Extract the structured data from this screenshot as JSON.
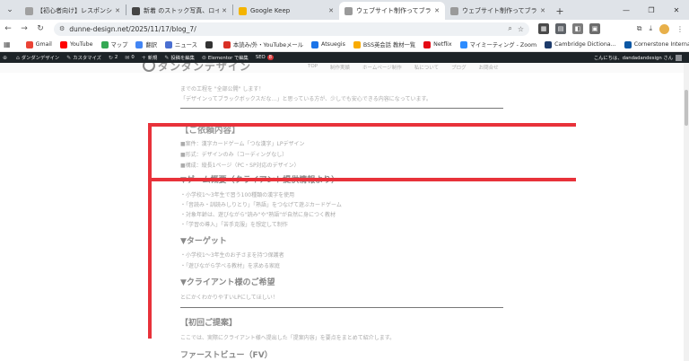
{
  "tabs": [
    {
      "title": "【初心者向け】レスポンシブデザインとは",
      "active": false,
      "color": "#a0a0a0"
    },
    {
      "title": "新着 のストック写真、ロイヤリティフリー",
      "active": false,
      "color": "#444444"
    },
    {
      "title": "Google Keep",
      "active": false,
      "color": "#f4b400"
    },
    {
      "title": "ウェブサイト制作ってブラックボックス",
      "active": true,
      "color": "#9a9a9a"
    },
    {
      "title": "ウェブサイト制作ってブラックボックス",
      "active": false,
      "color": "#9a9a9a"
    }
  ],
  "toolbar": {
    "url": "dunne-design.net/2025/11/17/blog_7/"
  },
  "bookmarks": [
    {
      "label": "Gmail",
      "color": "#ea4335"
    },
    {
      "label": "YouTube",
      "color": "#ff0000"
    },
    {
      "label": "マップ",
      "color": "#34a853"
    },
    {
      "label": "翻訳",
      "color": "#4285f4"
    },
    {
      "label": "ニュース",
      "color": "#4a6fd1"
    },
    {
      "label": "",
      "color": "#333333"
    },
    {
      "label": "本読み/外・YouTubeメール",
      "color": "#d93025"
    },
    {
      "label": "Atsuegis",
      "color": "#1a73e8"
    },
    {
      "label": "BSS英会話 教材一覧",
      "color": "#f9ab00"
    },
    {
      "label": "Netflix",
      "color": "#e50914"
    },
    {
      "label": "マイミーティング - Zoom",
      "color": "#2d8cff"
    },
    {
      "label": "Cambridge Dictiona...",
      "color": "#1d3b6b"
    },
    {
      "label": "Cornerstone Interna...",
      "color": "#0b57a4"
    }
  ],
  "bookmarks_all": "All Bookmarks",
  "adminbar": {
    "site": "ダンダンデザイン",
    "customize": "カスタマイズ",
    "updates": "2",
    "comments": "0",
    "new": "新規",
    "edit": "投稿を編集",
    "elementor": "Elementor で編集",
    "seo": "SEO",
    "seo_badge": "8",
    "greeting": "こんにちは、dandadandesign さん"
  },
  "site": {
    "logo": "ダンダンデザイン",
    "nav": [
      "TOP",
      "制作実績",
      "ホームページ制作",
      "私について",
      "ブログ",
      "お問合せ"
    ]
  },
  "content": {
    "intro1": "までの工程を \"全部公開\" します！",
    "intro2": "「デザインってブラックボックスだな…」と思っている方が、少しでも安心できる内容になっています。",
    "h_overview": "【ご依頼内容】",
    "overview": [
      "■案件：漢字カードゲーム「つな漢字」LPデザイン",
      "■形式：デザインのみ（コーディングなし）",
      "■構成：縦長1ページ（PC・SP対応のデザイン）"
    ],
    "h_game": "▼ゲーム概要（クライアント提供情報より）",
    "game": [
      "・小学校1〜3年生で習う100種類の漢字を使用",
      "・「音読み・訓読みしりとり」「熟語」をつなげて遊ぶカードゲーム",
      "・対象年齢は、遊びながら\"読み\"や\"熟語\"が自然に身につく教材",
      "・「学習の導入」「苦手克服」を想定して制作"
    ],
    "h_target": "▼ターゲット",
    "target": [
      "・小学校1〜3年生のお子さまを持つ保護者",
      "・「遊びながら学べる教材」を求める家庭"
    ],
    "h_wish": "▼クライアント様のご希望",
    "wish": "とにかくわかりやすいLPにしてほしい！",
    "h_proposal": "【初回ご提案】",
    "proposal": "ここでは、実際にクライアント様へ提出した「提案内容」を要点をまとめて紹介します。",
    "h_fv": "ファーストビュー（FV）"
  }
}
